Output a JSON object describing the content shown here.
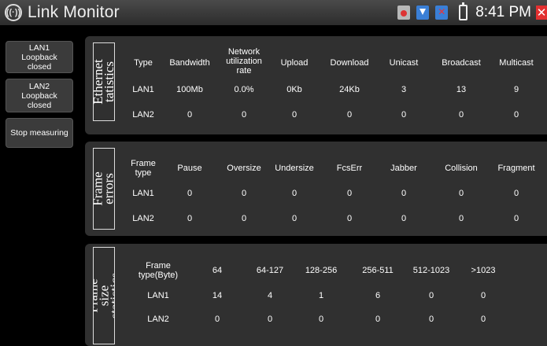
{
  "title_bar": {
    "app_title": "Link Monitor",
    "app_icon": "wifi-symbol-icon",
    "time": "8:41 PM",
    "status_icons": [
      "record-icon",
      "download-icon",
      "usb-error-icon",
      "battery-icon",
      "close-icon"
    ]
  },
  "buttons": {
    "lan1_loopback": "LAN1 Loopback closed",
    "lan2_loopback": "LAN2 Loopback closed",
    "stop_measuring": "Stop measuring"
  },
  "ethernet_statistics": {
    "label": "Ethernet tatistics",
    "headers": [
      "Type",
      "Bandwidth",
      "Network utilization rate",
      "Upload",
      "Download",
      "Unicast",
      "Broadcast",
      "Multicast"
    ],
    "rows": [
      [
        "LAN1",
        "100Mb",
        "0.0%",
        "0Kb",
        "24Kb",
        "3",
        "13",
        "9"
      ],
      [
        "LAN2",
        "0",
        "0",
        "0",
        "0",
        "0",
        "0",
        "0"
      ]
    ]
  },
  "frame_errors": {
    "label": "Frame errors",
    "headers": [
      "Frame type",
      "Pause",
      "Oversize",
      "Undersize",
      "FcsErr",
      "Jabber",
      "Collision",
      "Fragment"
    ],
    "rows": [
      [
        "LAN1",
        "0",
        "0",
        "0",
        "0",
        "0",
        "0",
        "0"
      ],
      [
        "LAN2",
        "0",
        "0",
        "0",
        "0",
        "0",
        "0",
        "0"
      ]
    ]
  },
  "frame_size_statistics": {
    "label": "Frame size statistics",
    "headers": [
      "Frame type(Byte)",
      "64",
      "64-127",
      "128-256",
      "256-511",
      "512-1023",
      ">1023"
    ],
    "rows": [
      [
        "LAN1",
        "14",
        "4",
        "1",
        "6",
        "0",
        "0"
      ],
      [
        "LAN2",
        "0",
        "0",
        "0",
        "0",
        "0",
        "0"
      ]
    ]
  }
}
